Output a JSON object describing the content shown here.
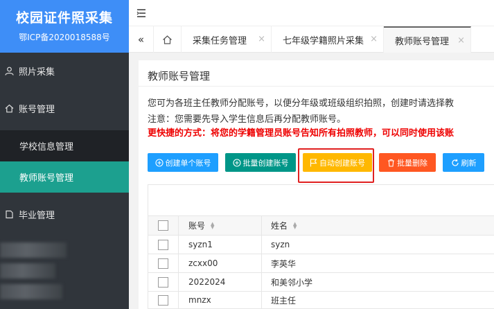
{
  "brand": {
    "title": "校园证件照采集",
    "icp": "鄂ICP备2020018588号"
  },
  "sidebar": {
    "items": [
      {
        "label": "照片采集",
        "icon": "user-icon"
      },
      {
        "label": "账号管理",
        "icon": "home-icon"
      },
      {
        "label": "学校信息管理"
      },
      {
        "label": "教师账号管理",
        "active": true
      },
      {
        "label": "毕业管理",
        "icon": "document-icon"
      }
    ]
  },
  "tabs": [
    {
      "label": "采集任务管理"
    },
    {
      "label": "七年级学籍照片采集"
    },
    {
      "label": "教师账号管理",
      "active": true
    }
  ],
  "panel": {
    "title": "教师账号管理",
    "desc1": "您可为各班主任教师分配账号，以便分年级或班级组织拍照，创建时请选择教",
    "desc2": "注意：您需要先导入学生信息后再分配教师账号。",
    "desc3": "更快捷的方式：将您的学籍管理员账号告知所有拍照教师，可以同时使用该账"
  },
  "buttons": {
    "create_single": "创建单个账号",
    "batch_create": "批量创建账号",
    "auto_create": "自动创建账号",
    "batch_delete": "批量删除",
    "refresh": "刷新"
  },
  "colors": {
    "brand": "#3e8ef7",
    "active_nav": "#1ca08f",
    "blue_btn": "#1e9fff",
    "green_btn": "#009688",
    "yellow_btn": "#ffb800",
    "red_btn": "#ff5722"
  },
  "table": {
    "headers": {
      "account": "账号",
      "name": "姓名"
    },
    "rows": [
      {
        "account": "syzn1",
        "name": "syzn"
      },
      {
        "account": "zcxx00",
        "name": "李英华"
      },
      {
        "account": "2022024",
        "name": "和美邻小学"
      },
      {
        "account": "mnzx",
        "name": "班主任"
      }
    ]
  }
}
